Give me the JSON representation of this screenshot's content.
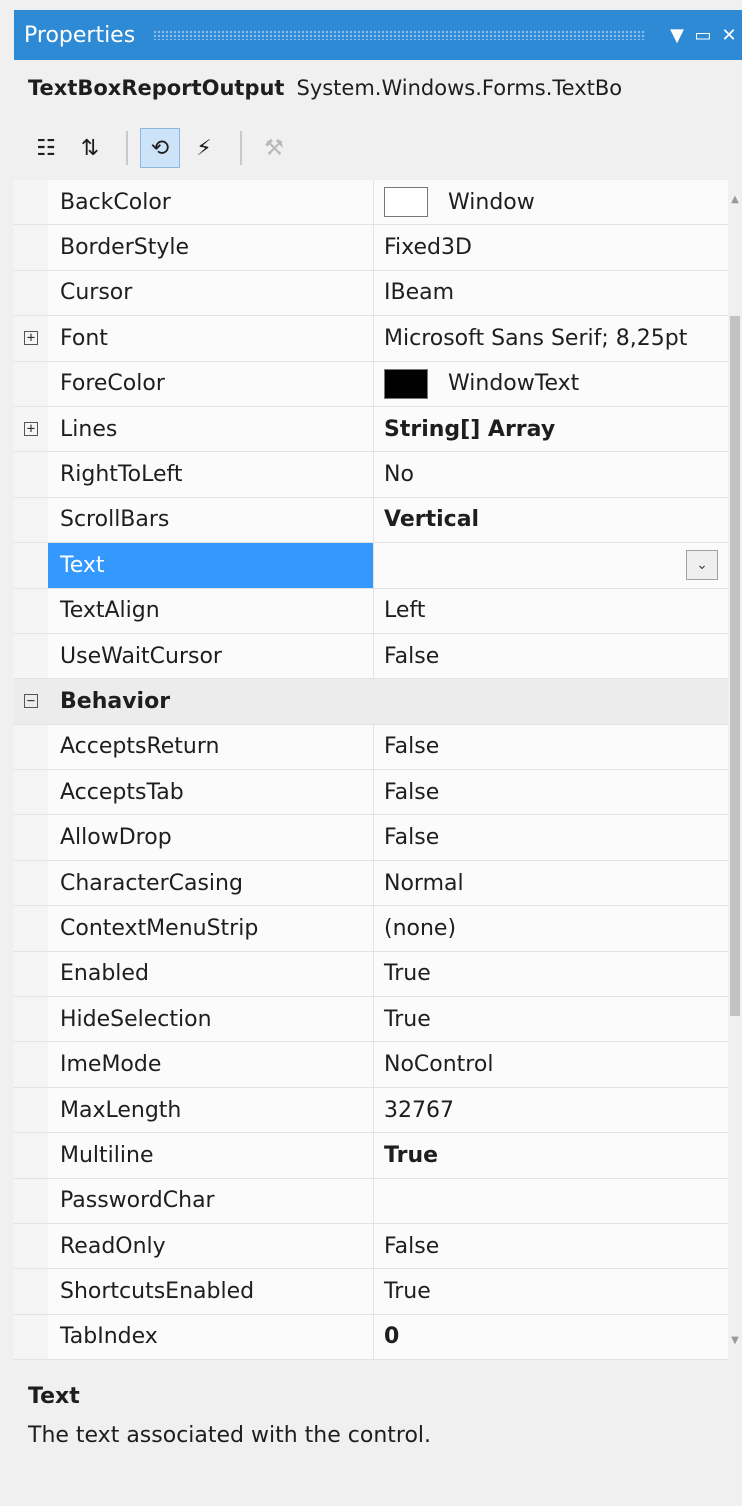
{
  "window": {
    "title": "Properties",
    "icons": {
      "dropdown": "dropdown-arrow-icon",
      "maximize": "maximize-icon",
      "close": "close-icon"
    }
  },
  "object_selector": {
    "name": "TextBoxReportOutput",
    "type": "System.Windows.Forms.TextBo"
  },
  "toolbar": {
    "buttons": [
      {
        "icon": "categorized-icon",
        "active": false
      },
      {
        "icon": "alphabetical-icon",
        "active": false
      },
      {
        "icon": "properties-icon",
        "active": true
      },
      {
        "icon": "events-icon",
        "active": false
      },
      {
        "icon": "property-pages-icon",
        "active": false,
        "disabled": true
      }
    ]
  },
  "properties": [
    {
      "name": "BackColor",
      "value": "Window",
      "swatch": "#ffffff"
    },
    {
      "name": "BorderStyle",
      "value": "Fixed3D"
    },
    {
      "name": "Cursor",
      "value": "IBeam"
    },
    {
      "name": "Font",
      "value": "Microsoft Sans Serif; 8,25pt",
      "expandable": true
    },
    {
      "name": "ForeColor",
      "value": "WindowText",
      "swatch": "#000000"
    },
    {
      "name": "Lines",
      "value": "String[] Array",
      "bold": true,
      "expandable": true
    },
    {
      "name": "RightToLeft",
      "value": "No"
    },
    {
      "name": "ScrollBars",
      "value": "Vertical",
      "bold": true
    },
    {
      "name": "Text",
      "value": "",
      "selected": true
    },
    {
      "name": "TextAlign",
      "value": "Left"
    },
    {
      "name": "UseWaitCursor",
      "value": "False"
    },
    {
      "category": "Behavior"
    },
    {
      "name": "AcceptsReturn",
      "value": "False"
    },
    {
      "name": "AcceptsTab",
      "value": "False"
    },
    {
      "name": "AllowDrop",
      "value": "False"
    },
    {
      "name": "CharacterCasing",
      "value": "Normal"
    },
    {
      "name": "ContextMenuStrip",
      "value": "(none)"
    },
    {
      "name": "Enabled",
      "value": "True"
    },
    {
      "name": "HideSelection",
      "value": "True"
    },
    {
      "name": "ImeMode",
      "value": "NoControl"
    },
    {
      "name": "MaxLength",
      "value": "32767"
    },
    {
      "name": "Multiline",
      "value": "True",
      "bold": true
    },
    {
      "name": "PasswordChar",
      "value": ""
    },
    {
      "name": "ReadOnly",
      "value": "False"
    },
    {
      "name": "ShortcutsEnabled",
      "value": "True"
    },
    {
      "name": "TabIndex",
      "value": "0",
      "bold": true
    }
  ],
  "description": {
    "title": "Text",
    "text": "The text associated with the control."
  },
  "colors": {
    "title_bar": "#2f8ad6",
    "selection": "#3399ff"
  }
}
